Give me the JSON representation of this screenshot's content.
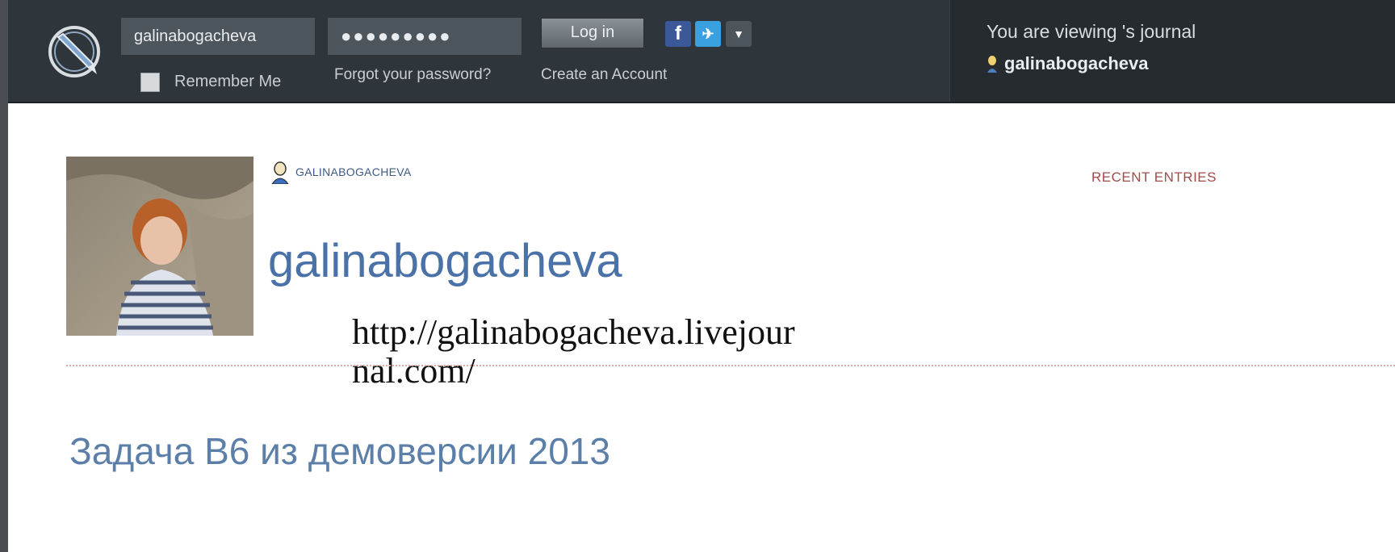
{
  "header": {
    "username_value": "galinabogacheva",
    "password_value": "●●●●●●●●●",
    "login_label": "Log in",
    "remember_label": "Remember Me",
    "forgot_label": "Forgot your password?",
    "create_label": "Create an Account",
    "viewing_text": "You are viewing 's journal",
    "viewing_user": "galinabogacheva",
    "social": [
      "facebook-icon",
      "twitter-icon",
      "dropdown-icon"
    ]
  },
  "journal": {
    "small_username": "GALINABOGACHEVA",
    "nav_recent": "RECENT ENTRIES",
    "title": "galinabogacheva",
    "url_overlay": "http://galinabogacheva.livejour nal.com/",
    "post_title": "Задача В6 из демоверсии 2013"
  },
  "colors": {
    "topbar": "#2e353b",
    "title_blue": "#4a72a8",
    "recent_red": "#a44a4a",
    "divider": "#e0a7a7"
  }
}
